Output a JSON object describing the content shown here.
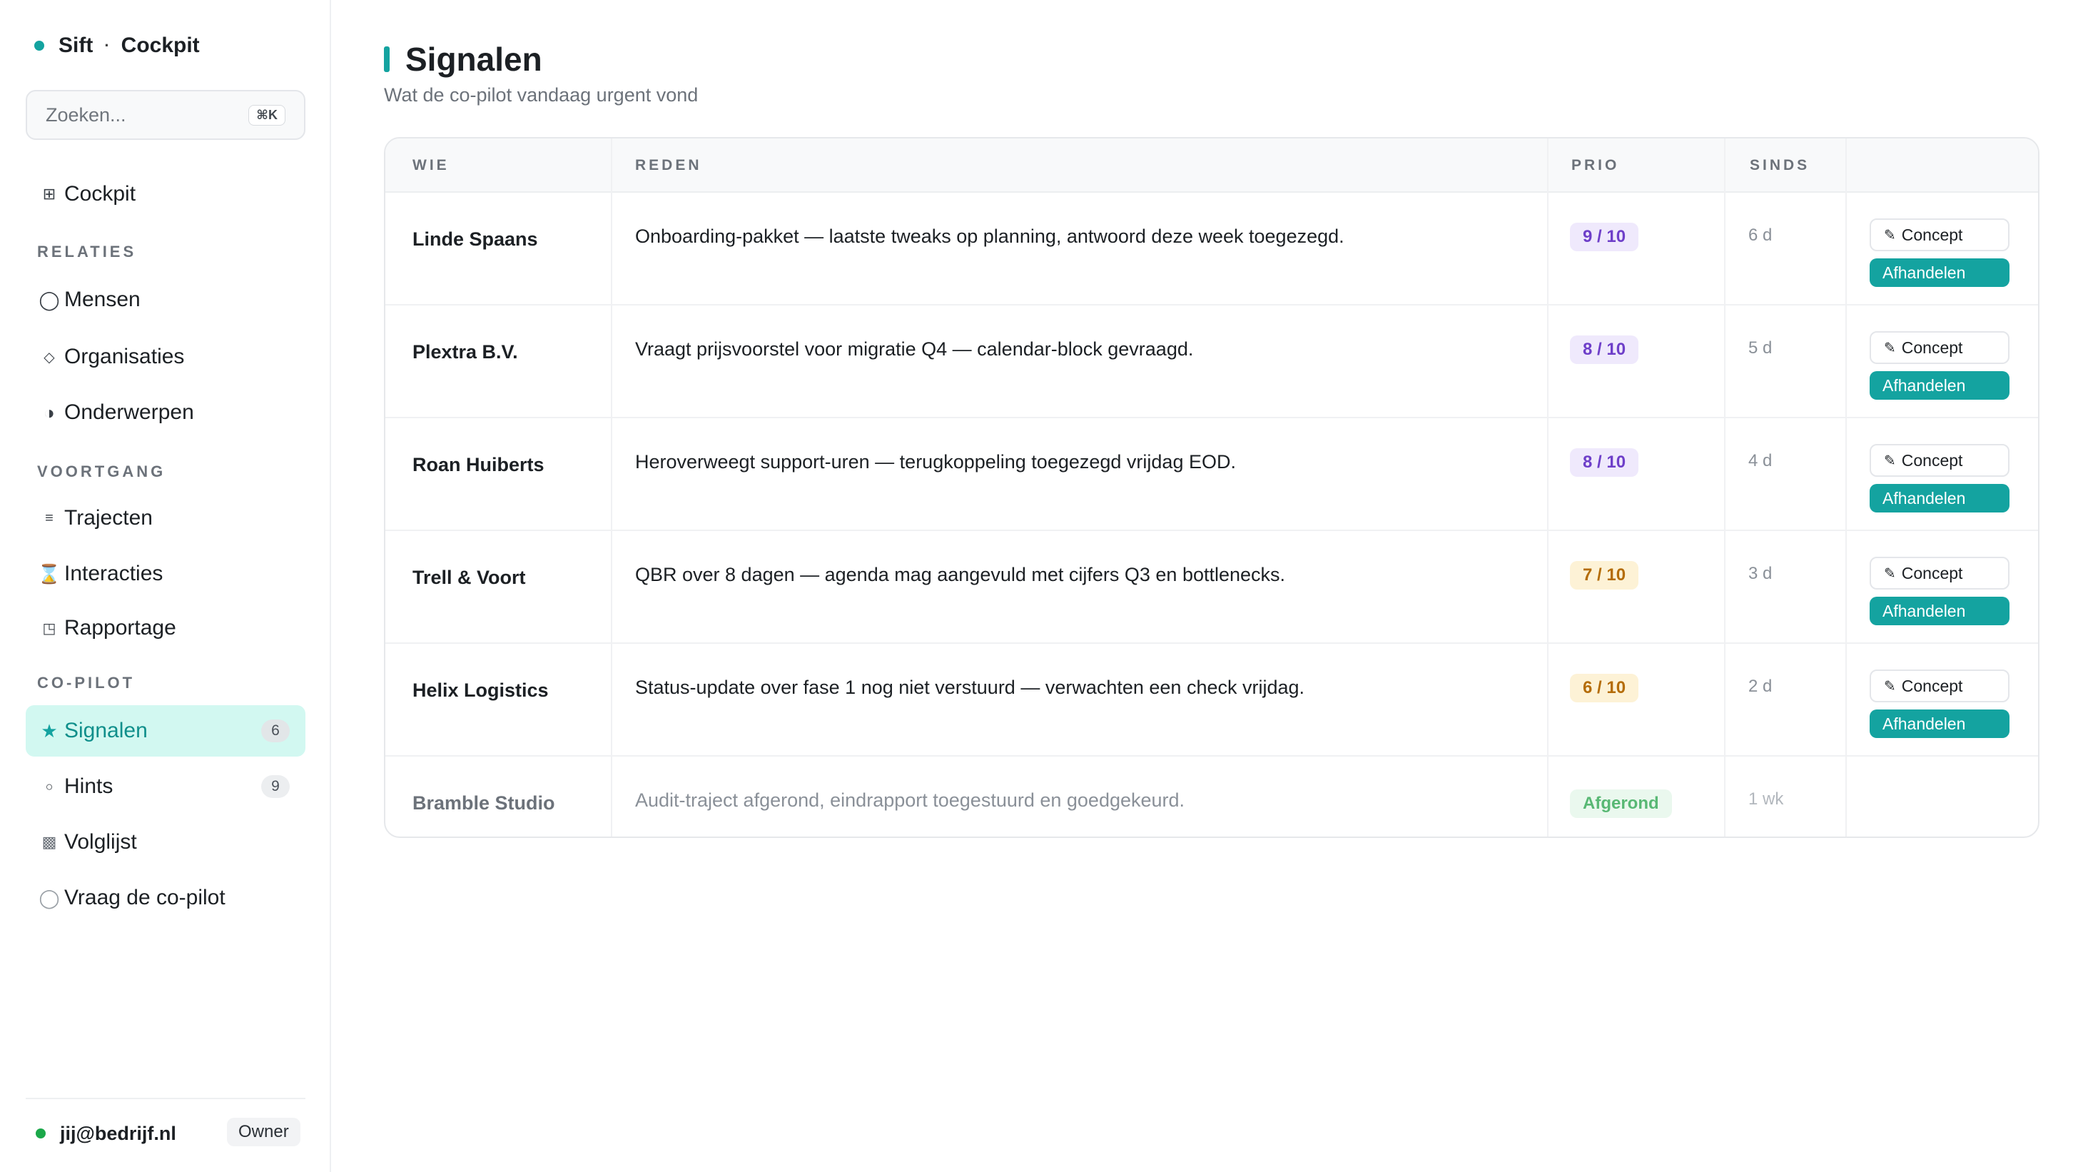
{
  "brand": {
    "name": "Sift",
    "separator": "·",
    "section": "Cockpit"
  },
  "search": {
    "placeholder": "Zoeken...",
    "shortcut": "⌘K"
  },
  "nav": {
    "cockpit": {
      "label": "Cockpit",
      "icon": "grid-icon"
    },
    "sections": {
      "relaties": "RELATIES",
      "voortgang": "VOORTGANG",
      "copilot": "CO-PILOT"
    },
    "mensen": {
      "label": "Mensen",
      "icon": "circle-icon"
    },
    "organisaties": {
      "label": "Organisaties",
      "icon": "diamond-icon"
    },
    "onderwerpen": {
      "label": "Onderwerpen",
      "icon": "half-circle-icon"
    },
    "trajecten": {
      "label": "Trajecten",
      "icon": "lines-icon"
    },
    "interacties": {
      "label": "Interacties",
      "icon": "hourglass-icon"
    },
    "rapportage": {
      "label": "Rapportage",
      "icon": "report-icon"
    },
    "signalen": {
      "label": "Signalen",
      "icon": "star-icon",
      "count": "6"
    },
    "hints": {
      "label": "Hints",
      "icon": "small-circle-icon",
      "count": "9"
    },
    "volglijst": {
      "label": "Volglijst",
      "icon": "square-icon"
    },
    "vraag": {
      "label": "Vraag de co-pilot",
      "icon": "empty-circle-icon"
    }
  },
  "user": {
    "email": "jij@bedrijf.nl",
    "role": "Owner"
  },
  "page": {
    "title": "Signalen",
    "subtitle": "Wat de co-pilot vandaag urgent vond"
  },
  "table": {
    "headers": {
      "wie": "WIE",
      "reden": "REDEN",
      "prio": "PRIO",
      "sinds": "SINDS"
    },
    "actions": {
      "concept": "Concept",
      "handle": "Afhandelen"
    },
    "rows": [
      {
        "who": "Linde Spaans",
        "reason": "Onboarding-pakket — laatste tweaks op planning, antwoord deze week toegezegd.",
        "prio": "9 / 10",
        "since": "6 d"
      },
      {
        "who": "Plextra B.V.",
        "reason": "Vraagt prijsvoorstel voor migratie Q4 — calendar-block gevraagd.",
        "prio": "8 / 10",
        "since": "5 d"
      },
      {
        "who": "Roan Huiberts",
        "reason": "Heroverweegt support-uren — terugkoppeling toegezegd vrijdag EOD.",
        "prio": "8 / 10",
        "since": "4 d"
      },
      {
        "who": "Trell & Voort",
        "reason": "QBR over 8 dagen — agenda mag aangevuld met cijfers Q3 en bottlenecks.",
        "prio": "7 / 10",
        "since": "3 d"
      },
      {
        "who": "Helix Logistics",
        "reason": "Status-update over fase 1 nog niet verstuurd — verwachten een check vrijdag.",
        "prio": "6 / 10",
        "since": "2 d"
      },
      {
        "who": "Bramble Studio",
        "reason": "Audit-traject afgerond, eindrapport toegestuurd en goedgekeurd.",
        "prio": "Afgerond",
        "since": "1 wk"
      }
    ]
  },
  "colors": {
    "accent": "#14a3a0",
    "active_bg": "#d2f8f1",
    "prio_high": "#6e3fc9",
    "prio_mid": "#b46c07",
    "done": "#58b874"
  }
}
